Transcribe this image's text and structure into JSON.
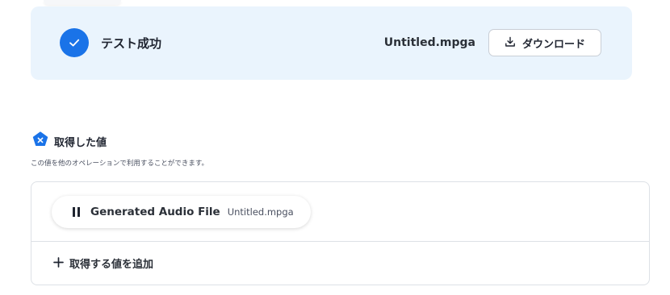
{
  "result": {
    "title": "テスト成功",
    "filename": "Untitled.mpga",
    "download_label": "ダウンロード",
    "status": "success",
    "accent_color": "#1a73e8",
    "card_background": "#eaf4fd"
  },
  "captured_values": {
    "title": "取得した値",
    "description": "この値を他のオペレーションで利用することができます。",
    "icon": "variable-badge-icon",
    "items": [
      {
        "icon": "pause-icon",
        "label": "Generated Audio File",
        "filename": "Untitled.mpga"
      }
    ],
    "add_label": "取得する値を追加"
  }
}
